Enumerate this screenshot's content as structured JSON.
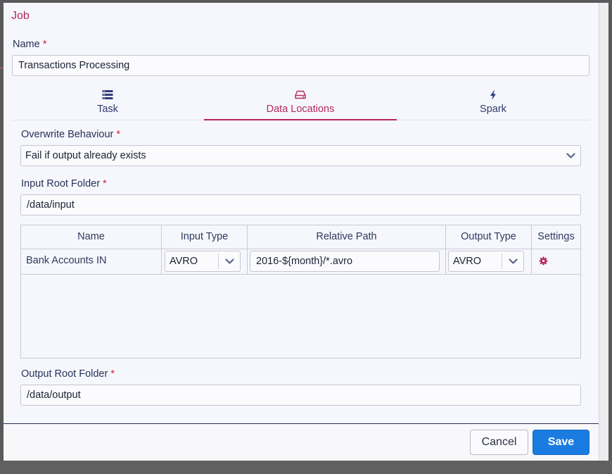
{
  "dialog": {
    "title": "Job"
  },
  "name_field": {
    "label": "Name",
    "required_mark": "*",
    "value": "Transactions Processing"
  },
  "tabs": [
    {
      "label": "Task",
      "icon": "list-icon",
      "active": false
    },
    {
      "label": "Data Locations",
      "icon": "drive-icon",
      "active": true
    },
    {
      "label": "Spark",
      "icon": "lightning-icon",
      "active": false
    }
  ],
  "overwrite": {
    "label": "Overwrite Behaviour",
    "required_mark": "*",
    "selected": "Fail if output already exists"
  },
  "input_root": {
    "label": "Input Root Folder",
    "required_mark": "*",
    "value": "/data/input"
  },
  "table": {
    "columns": [
      "Name",
      "Input Type",
      "Relative Path",
      "Output Type",
      "Settings"
    ],
    "rows": [
      {
        "name": "Bank Accounts IN",
        "input_type": "AVRO",
        "relative_path": "2016-${month}/*.avro",
        "output_type": "AVRO",
        "settings_icon": "gear-icon"
      }
    ]
  },
  "output_root": {
    "label": "Output Root Folder",
    "required_mark": "*",
    "value": "/data/output"
  },
  "footer": {
    "cancel_label": "Cancel",
    "save_label": "Save"
  },
  "colors": {
    "accent": "#b5275d",
    "primary_button": "#1a7be0",
    "required": "#d0233b",
    "text": "#27305a"
  }
}
